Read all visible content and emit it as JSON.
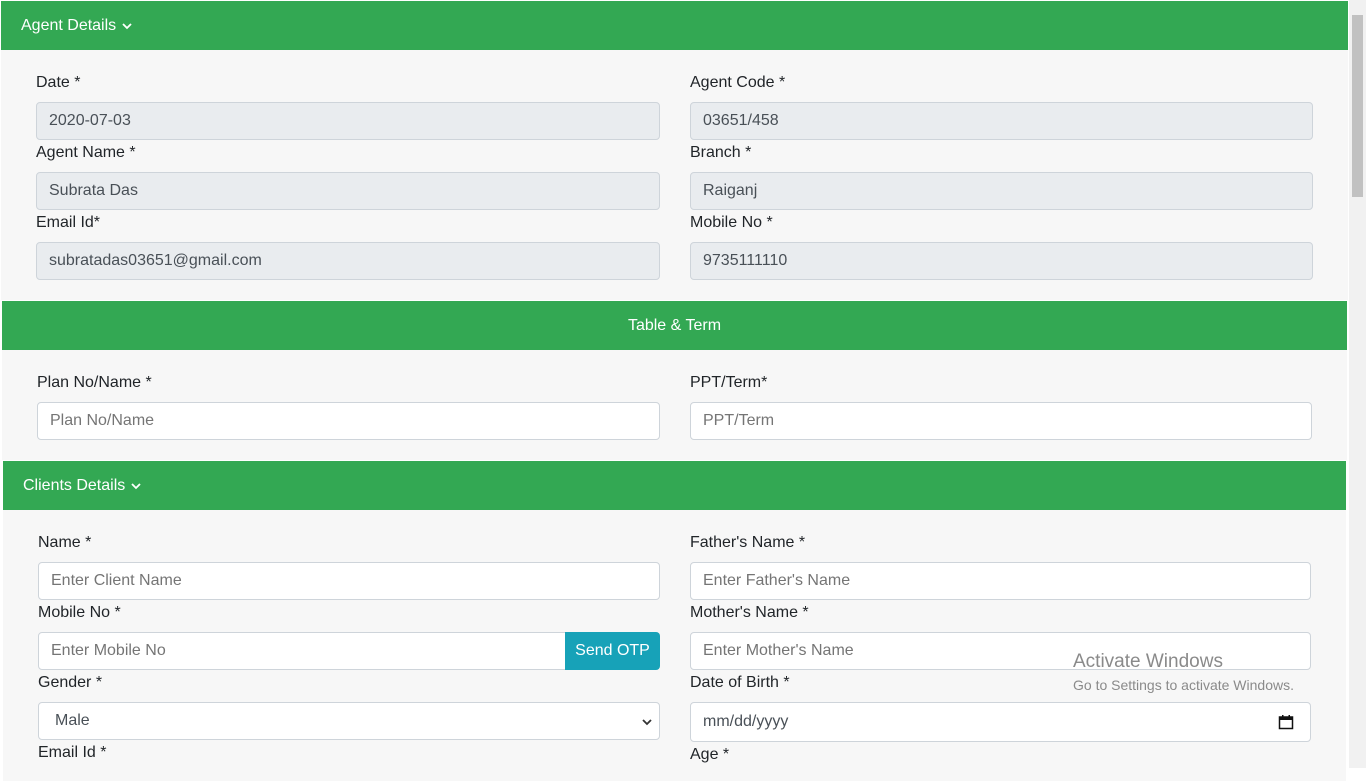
{
  "agent_details": {
    "title": "Agent Details",
    "date": {
      "label": "Date *",
      "value": "2020-07-03"
    },
    "agent_code": {
      "label": "Agent Code *",
      "value": "03651/458"
    },
    "agent_name": {
      "label": "Agent Name *",
      "value": "Subrata Das"
    },
    "branch": {
      "label": "Branch *",
      "value": "Raiganj"
    },
    "email": {
      "label": "Email Id*",
      "value": "subratadas03651@gmail.com"
    },
    "mobile": {
      "label": "Mobile No *",
      "value": "9735111110"
    }
  },
  "table_term": {
    "title": "Table & Term",
    "plan": {
      "label": "Plan No/Name *",
      "placeholder": "Plan No/Name"
    },
    "ppt": {
      "label": "PPT/Term*",
      "placeholder": "PPT/Term"
    }
  },
  "clients_details": {
    "title": "Clients Details",
    "name": {
      "label": "Name *",
      "placeholder": "Enter Client Name"
    },
    "father": {
      "label": "Father's Name *",
      "placeholder": "Enter Father's Name"
    },
    "mobile": {
      "label": "Mobile No *",
      "placeholder": "Enter Mobile No",
      "button": "Send OTP"
    },
    "mother": {
      "label": "Mother's Name *",
      "placeholder": "Enter Mother's Name"
    },
    "gender": {
      "label": "Gender *",
      "value": "Male"
    },
    "dob": {
      "label": "Date of Birth *",
      "placeholder": "mm/dd/yyyy"
    },
    "email": {
      "label": "Email Id *"
    },
    "age": {
      "label": "Age *"
    }
  },
  "watermark": {
    "line1": "Activate Windows",
    "line2": "Go to Settings to activate Windows."
  },
  "colors": {
    "header": "#33a853",
    "otp_button": "#17a2b8",
    "readonly_bg": "#e9ecef"
  },
  "icons": [
    "chevron-down-icon",
    "calendar-icon",
    "select-arrow-icon"
  ]
}
